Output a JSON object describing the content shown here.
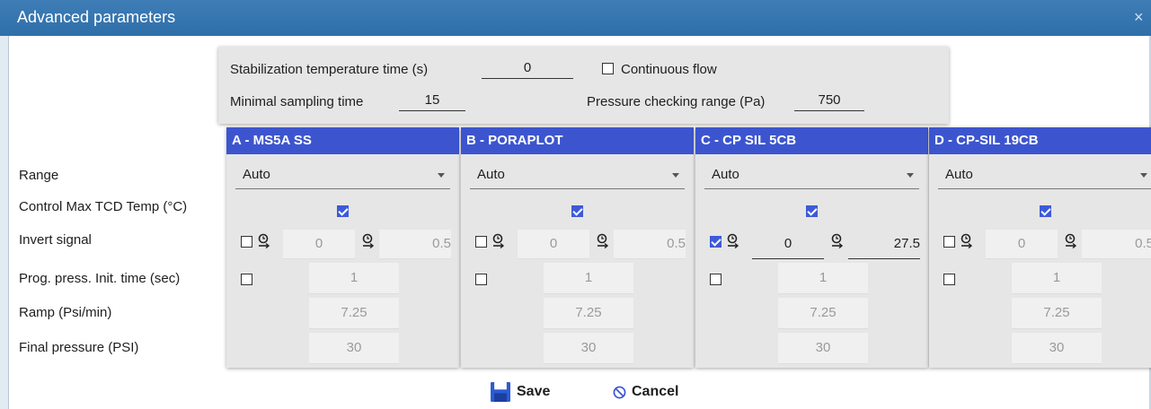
{
  "window": {
    "title": "Advanced parameters",
    "close": "×"
  },
  "global": {
    "stab_label": "Stabilization temperature time (s)",
    "stab_value": "0",
    "continuous_label": "Continuous flow",
    "continuous_checked": false,
    "minimal_label": "Minimal sampling time",
    "minimal_value": "15",
    "pressure_label": "Pressure checking range (Pa)",
    "pressure_value": "750"
  },
  "rows": {
    "range": "Range",
    "control": "Control Max TCD Temp (°C)",
    "invert": "Invert signal",
    "prog": "Prog. press. Init. time (sec)",
    "ramp": "Ramp (Psi/min)",
    "final": "Final pressure (PSI)"
  },
  "columns": [
    {
      "name": "A - MS5A SS",
      "range": "Auto",
      "control": true,
      "invert": false,
      "start": "0",
      "end": "0.5",
      "prog_checked": false,
      "prog": "1",
      "ramp": "7.25",
      "final": "30"
    },
    {
      "name": "B - PORAPLOT",
      "range": "Auto",
      "control": true,
      "invert": false,
      "start": "0",
      "end": "0.5",
      "prog_checked": false,
      "prog": "1",
      "ramp": "7.25",
      "final": "30"
    },
    {
      "name": "C - CP SIL 5CB",
      "range": "Auto",
      "control": true,
      "invert": true,
      "start": "0",
      "end": "27.5",
      "prog_checked": false,
      "prog": "1",
      "ramp": "7.25",
      "final": "30"
    },
    {
      "name": "D - CP-SIL 19CB",
      "range": "Auto",
      "control": true,
      "invert": false,
      "start": "0",
      "end": "0.5",
      "prog_checked": false,
      "prog": "1",
      "ramp": "7.25",
      "final": "30"
    }
  ],
  "buttons": {
    "save": "Save",
    "cancel": "Cancel"
  },
  "colors": {
    "accent": "#3c55cf",
    "titlebar": "#2f6fa9"
  }
}
